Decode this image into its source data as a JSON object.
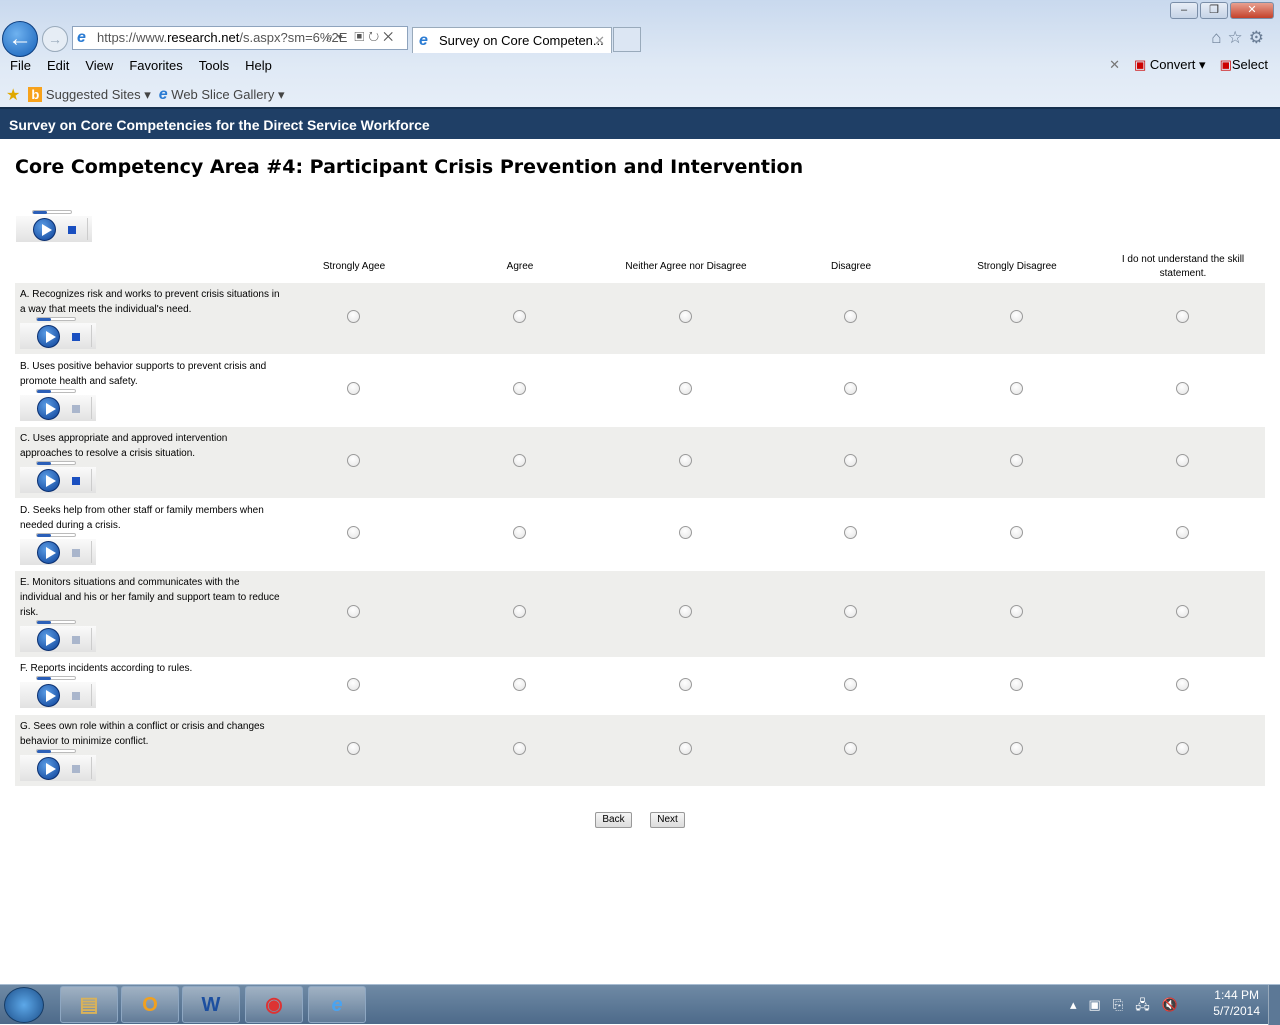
{
  "browser": {
    "url_domain_prefix": "https://www.",
    "url_domain": "research.net",
    "url_path": "/s.aspx?sm=6%2E",
    "tab_title": "Survey on Core Competen...",
    "menu": [
      "File",
      "Edit",
      "View",
      "Favorites",
      "Tools",
      "Help"
    ],
    "convert": "Convert",
    "select": "Select",
    "favorites": [
      "Suggested Sites",
      "Web Slice Gallery"
    ]
  },
  "page": {
    "banner": "Survey on Core Competencies for the Direct Service Workforce",
    "heading": "Core Competency Area #4: Participant Crisis Prevention and Intervention",
    "columns": [
      "Strongly Agee",
      "Agree",
      "Neither Agree nor Disagree",
      "Disagree",
      "Strongly Disagree",
      "I do not understand the skill statement."
    ],
    "questions": [
      "A. Recognizes risk and works to prevent crisis situations in a way that meets the individual's need.",
      "B. Uses positive behavior supports to prevent crisis and promote health and safety.",
      "C. Uses appropriate and approved intervention approaches to resolve a crisis situation.",
      "D. Seeks help from other staff or family members when needed during a crisis.",
      "E. Monitors situations and communicates with the individual and his or her family and support team to reduce risk.",
      "F. Reports incidents according to rules.",
      "G. Sees own role within a conflict or crisis and changes behavior to minimize conflict."
    ],
    "back": "Back",
    "next": "Next"
  },
  "taskbar": {
    "time": "1:44 PM",
    "date": "5/7/2014"
  }
}
